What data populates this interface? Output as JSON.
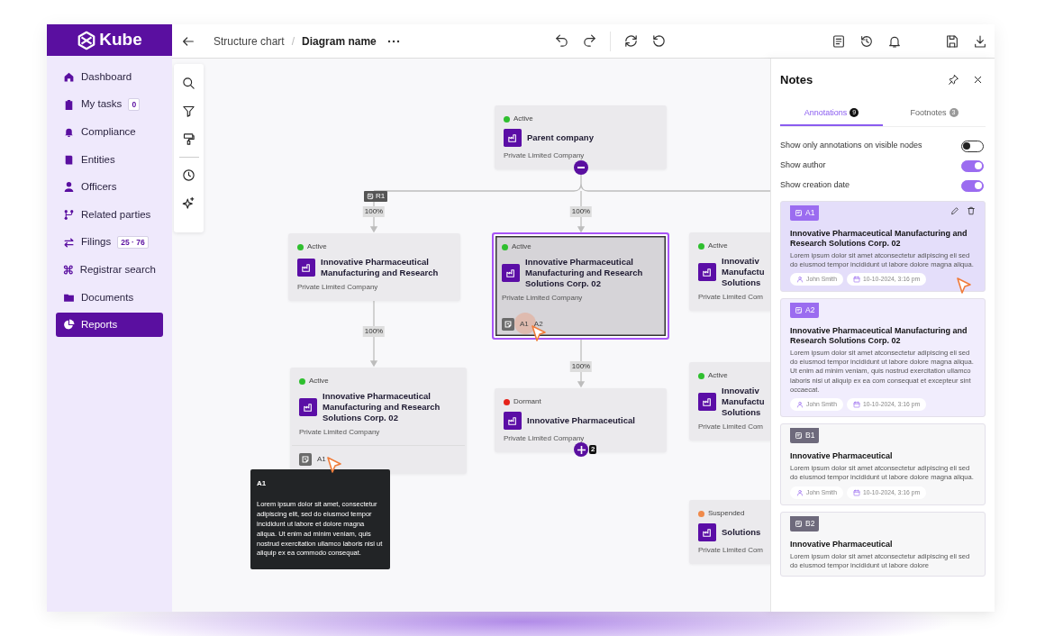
{
  "app": {
    "logo": "Kube"
  },
  "sidebar": {
    "items": [
      {
        "label": "Dashboard",
        "selected": false
      },
      {
        "label": "My tasks",
        "badge": "0",
        "selected": false
      },
      {
        "label": "Compliance",
        "selected": false
      },
      {
        "label": "Entities",
        "selected": false
      },
      {
        "label": "Officers",
        "selected": false
      },
      {
        "label": "Related parties",
        "selected": false
      },
      {
        "label": "Filings",
        "badge": "25 · 76",
        "selected": false
      },
      {
        "label": "Registrar search",
        "selected": false
      },
      {
        "label": "Documents",
        "selected": false
      },
      {
        "label": "Reports",
        "selected": true
      }
    ]
  },
  "topbar": {
    "breadcrumb": [
      {
        "label": "Structure chart",
        "current": false
      },
      {
        "label": "Diagram name",
        "current": true
      }
    ],
    "separator": "/"
  },
  "canvas": {
    "nodes": [
      {
        "status": "Active",
        "color": "#2fbf2f",
        "name": "Parent company",
        "subtitle": "Private Limited Company",
        "selected": false
      },
      {
        "status": "Active",
        "color": "#2fbf2f",
        "name": "Innovative Pharmaceutical Manufacturing and Research",
        "subtitle": "Private Limited Company",
        "selected": false
      },
      {
        "status": "Active",
        "color": "#2fbf2f",
        "name": "Innovative Pharmaceutical Manufacturing and Research Solutions Corp. 02",
        "subtitle": "Private Limited Company",
        "selected": true,
        "annotations": [
          "A1",
          "A2"
        ]
      },
      {
        "status": "Active",
        "color": "#2fbf2f",
        "name": "Innovativ\nManufactu\nSolutions",
        "subtitle": "Private Limited Com",
        "selected": false
      },
      {
        "status": "Active",
        "color": "#2fbf2f",
        "name": "Innovative Pharmaceutical Manufacturing and Research Solutions Corp. 02",
        "subtitle": "Private Limited Company",
        "selected": false,
        "annotations": [
          "A1"
        ]
      },
      {
        "status": "Dormant",
        "color": "#e5231b",
        "name": "Innovative Pharmaceutical",
        "subtitle": "Private Limited Company",
        "selected": false
      },
      {
        "status": "Active",
        "color": "#2fbf2f",
        "name": "Innovativ\nManufactu\nSolutions",
        "subtitle": "Private Limited Com",
        "selected": false
      },
      {
        "status": "Suspended",
        "color": "#f08a4b",
        "name": "Solutions",
        "subtitle": "Private Limited Com",
        "selected": false
      }
    ],
    "edges": [
      {
        "label": "100%",
        "tag": "R1"
      },
      {
        "label": "100%"
      },
      {
        "label": "100%"
      },
      {
        "label": "100%"
      }
    ],
    "children_count": "2",
    "tooltip": {
      "title": "A1",
      "text": "Lorem ipsum dolor sit amet, consectetur adipiscing elit, sed do eiusmod tempor incididunt ut labore et dolore magna aliqua. Ut enim ad minim veniam, quis nostrud exercitation ullamco laboris nisi ut aliquip ex ea commodo consequat."
    }
  },
  "notes": {
    "title": "Notes",
    "tabs": [
      {
        "label": "Annotations",
        "count": "9",
        "selected": true
      },
      {
        "label": "Footnotes",
        "count": "3",
        "selected": false
      }
    ],
    "toggles": [
      {
        "label": "Show only annotations on visible nodes",
        "on": false
      },
      {
        "label": "Show author",
        "on": true
      },
      {
        "label": "Show creation date",
        "on": true
      }
    ],
    "items": [
      {
        "kind": "annotation",
        "tag": "A1",
        "hovered": true,
        "title": "Innovative Pharmaceutical Manufacturing and Research Solutions Corp. 02",
        "text": "Lorem ipsum dolor sit amet atconsectetur adipiscing eli sed do eiusmod tempor incididunt ut labore dolore magna aliqua.",
        "author": "John Smith",
        "date": "10-10-2024, 3:16 pm"
      },
      {
        "kind": "annotation",
        "tag": "A2",
        "hovered": false,
        "title": "Innovative Pharmaceutical Manufacturing and Research Solutions Corp. 02",
        "text": "Lorem ipsum dolor sit amet atconsectetur adipiscing eli sed do eiusmod tempor incididunt ut labore dolore magna aliqua. Ut enim ad minim veniam, quis nostrud exercitation ullamco laboris nisi ut aliquip ex ea com consequat et excepteur sint occaecat.",
        "author": "John Smith",
        "date": "10-10-2024, 3:16 pm"
      },
      {
        "kind": "footnote",
        "tag": "B1",
        "hovered": false,
        "title": "Innovative Pharmaceutical",
        "text": "Lorem ipsum dolor sit amet atconsectetur adipiscing eli sed do eiusmod tempor incididunt ut labore dolore magna aliqua.",
        "author": "John Smith",
        "date": "10-10-2024, 3:16 pm"
      },
      {
        "kind": "footnote",
        "tag": "B2",
        "hovered": false,
        "title": "Innovative Pharmaceutical",
        "text": "Lorem ipsum dolor sit amet atconsectetur adipiscing eli sed do eiusmod tempor incididunt ut labore dolore"
      }
    ]
  }
}
